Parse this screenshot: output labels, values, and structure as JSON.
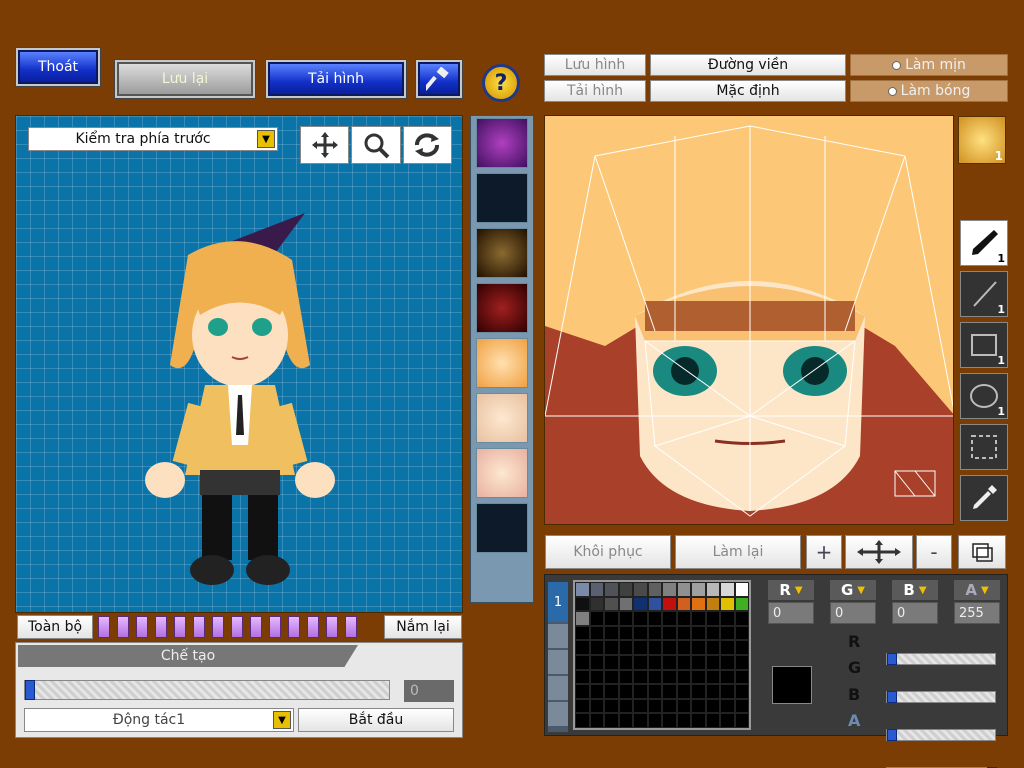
{
  "top_left": {
    "exit_label": "Thoát",
    "save_label": "Lưu lại",
    "load_label": "Tải hình"
  },
  "preview": {
    "view_select": "Kiểm tra phía trước",
    "all_label": "Toàn bộ",
    "grab_label": "Nắm lại",
    "make_header": "Chế tạo",
    "progress_value": "0",
    "action_select": "Động tác1",
    "start_label": "Bắt đầu"
  },
  "editor": {
    "save_image": "Lưu hình",
    "load_image": "Tải hình",
    "outline": "Đường viền",
    "default": "Mặc định",
    "smooth": "Làm mịn",
    "shade": "Làm bóng",
    "restore": "Khôi phục",
    "redo": "Làm lại",
    "plus": "+",
    "minus": "-",
    "face_num": "1"
  },
  "tools": [
    {
      "name": "pen-tool",
      "num": "1"
    },
    {
      "name": "line-tool",
      "num": "1"
    },
    {
      "name": "rect-tool",
      "num": "1"
    },
    {
      "name": "ellipse-tool",
      "num": "1"
    },
    {
      "name": "select-tool",
      "num": ""
    },
    {
      "name": "eyedropper-tool",
      "num": ""
    }
  ],
  "color": {
    "r_label": "R",
    "g_label": "G",
    "b_label": "B",
    "a_label": "A",
    "r": "0",
    "g": "0",
    "b": "0",
    "a": "255",
    "current": "#000000",
    "palette_tab": "1"
  },
  "palette_colors": [
    "#7a8aa8",
    "#5a6070",
    "#50525a",
    "#404040",
    "#4a4a4a",
    "#606060",
    "#808080",
    "#909090",
    "#a0a0a0",
    "#b8b8b8",
    "#d8d8d8",
    "#ffffff",
    "#101010",
    "#303030",
    "#505050",
    "#707070",
    "#103070",
    "#3050a0",
    "#c01010",
    "#d06020",
    "#e07010",
    "#c08010",
    "#e0c000",
    "#40b020",
    "#808080"
  ]
}
